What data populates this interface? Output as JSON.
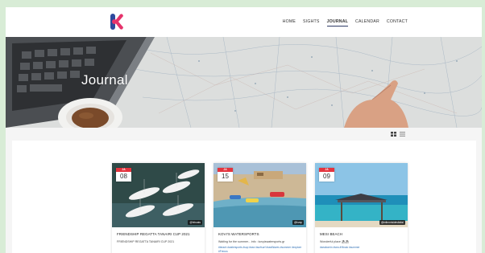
{
  "nav": {
    "items": [
      {
        "label": "HOME",
        "active": false
      },
      {
        "label": "SIGHTS",
        "active": false
      },
      {
        "label": "JOURNAL",
        "active": true
      },
      {
        "label": "CALENDAR",
        "active": false
      },
      {
        "label": "CONTACT",
        "active": false
      }
    ]
  },
  "hero": {
    "title": "Journal"
  },
  "cards": [
    {
      "month": "JA",
      "day": "08",
      "handle": "@fxboats",
      "title": "FRIENDSHIP REGATTA TANAIRI CUP 2021",
      "text": "FRIENDSHIP REGATTA TANAIRI CUP 2021",
      "tags": ""
    },
    {
      "month": "JA",
      "day": "15",
      "handle": "@kvap",
      "title": "KOVI'S WATERSPORTS",
      "text": "Waiting for the summer... info : kovyiswatersports.gr",
      "tags": "#beach #watersports #sup #sea #surfsurf #seaWaves #summer #explore #Freous"
    },
    {
      "month": "JA",
      "day": "09",
      "handle": "@mikronisidesilaksi",
      "title": "MESI BEACH",
      "text": "Wonderful place ⛱⛱",
      "tags": "#seabornin #sea #Hlnalo #summer"
    }
  ],
  "colors": {
    "accent": "#e3343e",
    "nav_active": "#2f3b66",
    "logo_pink": "#e6336b",
    "logo_blue": "#2e4a9e"
  }
}
